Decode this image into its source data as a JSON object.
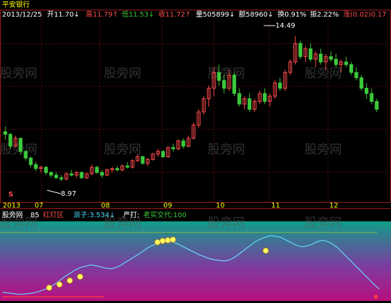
{
  "colors": {
    "up": "#ff4b4b",
    "down": "#3cc83c",
    "grid": "#a01818",
    "text_white": "#ffffff",
    "text_yellow": "#ffff00",
    "text_green": "#3cc83c",
    "text_red": "#ff4b4b",
    "text_cyan": "#55ddff",
    "axis_text": "#ffff00",
    "indicator_line": "#66d9ff",
    "marker_fill": "#ffff66",
    "ref_line": "#7fbf3f"
  },
  "header": {
    "stock_name": "平安银行",
    "date": "2013/12/25",
    "open_label": "开11.70↓",
    "high_label": "高11.79↑",
    "low_label": "低11.53↓",
    "close_label": "收11.72↑",
    "volume_label": "量505899↓",
    "amount_label": "额58960↓",
    "turnover_label": "换0.91%",
    "amplitude_label": "振2.22%",
    "change_label": "涨(0.02)0.17"
  },
  "annotations": {
    "high_marker": "14.49",
    "low_marker": "8.97",
    "s_marker": "S"
  },
  "xaxis": {
    "labels": [
      "2013",
      "07",
      "08",
      "09",
      "10",
      "11",
      "12"
    ]
  },
  "indicator": {
    "name": "股旁网",
    "value": "85",
    "signal_label": "红灯区",
    "wave_label": "浪子:3.534↓",
    "strike_label": "严打:",
    "ref_label": "老实交代:100"
  },
  "watermark": "股旁网",
  "chart_data": {
    "type": "candlestick",
    "title": "平安银行",
    "ylabel": "",
    "xlabel": "",
    "ylim": [
      8.6,
      14.8
    ],
    "x_tick_labels": [
      "2013",
      "07",
      "08",
      "09",
      "10",
      "11",
      "12"
    ],
    "candles_ohlc": [
      [
        10.85,
        11.05,
        10.55,
        10.75
      ],
      [
        10.75,
        10.8,
        10.2,
        10.3
      ],
      [
        10.3,
        10.7,
        10.25,
        10.6
      ],
      [
        10.6,
        10.62,
        10.0,
        10.1
      ],
      [
        10.1,
        10.15,
        9.75,
        9.85
      ],
      [
        9.85,
        9.9,
        9.5,
        9.6
      ],
      [
        9.6,
        9.7,
        9.35,
        9.45
      ],
      [
        9.45,
        9.55,
        9.3,
        9.5
      ],
      [
        9.5,
        9.55,
        9.2,
        9.3
      ],
      [
        9.3,
        9.35,
        9.1,
        9.2
      ],
      [
        9.2,
        9.3,
        9.05,
        9.1
      ],
      [
        9.1,
        9.2,
        8.97,
        9.05
      ],
      [
        9.05,
        9.3,
        9.0,
        9.25
      ],
      [
        9.25,
        9.4,
        9.15,
        9.2
      ],
      [
        9.2,
        9.35,
        9.1,
        9.3
      ],
      [
        9.3,
        9.35,
        9.05,
        9.1
      ],
      [
        9.1,
        9.3,
        9.05,
        9.25
      ],
      [
        9.25,
        9.6,
        9.2,
        9.5
      ],
      [
        9.5,
        9.55,
        9.25,
        9.3
      ],
      [
        9.3,
        9.4,
        9.1,
        9.2
      ],
      [
        9.2,
        9.45,
        9.15,
        9.4
      ],
      [
        9.4,
        9.5,
        9.3,
        9.45
      ],
      [
        9.45,
        9.55,
        9.35,
        9.4
      ],
      [
        9.4,
        9.6,
        9.35,
        9.55
      ],
      [
        9.55,
        9.7,
        9.45,
        9.5
      ],
      [
        9.5,
        9.8,
        9.45,
        9.75
      ],
      [
        9.75,
        10.0,
        9.7,
        9.9
      ],
      [
        9.9,
        9.95,
        9.6,
        9.65
      ],
      [
        9.65,
        9.85,
        9.55,
        9.8
      ],
      [
        9.8,
        10.05,
        9.75,
        10.0
      ],
      [
        10.0,
        10.2,
        9.9,
        10.1
      ],
      [
        10.1,
        10.15,
        9.85,
        9.9
      ],
      [
        9.9,
        10.3,
        9.85,
        10.25
      ],
      [
        10.25,
        10.4,
        10.1,
        10.2
      ],
      [
        10.2,
        10.55,
        10.15,
        10.5
      ],
      [
        10.5,
        10.6,
        10.2,
        10.3
      ],
      [
        10.3,
        10.7,
        10.25,
        10.6
      ],
      [
        10.6,
        11.2,
        10.55,
        11.1
      ],
      [
        11.1,
        11.7,
        11.0,
        11.6
      ],
      [
        11.6,
        12.2,
        11.5,
        12.1
      ],
      [
        12.1,
        12.6,
        11.8,
        12.5
      ],
      [
        12.5,
        13.3,
        12.2,
        13.1
      ],
      [
        13.1,
        13.4,
        12.6,
        12.8
      ],
      [
        12.8,
        13.0,
        12.3,
        12.5
      ],
      [
        12.5,
        13.2,
        12.4,
        13.0
      ],
      [
        13.0,
        13.1,
        12.2,
        12.3
      ],
      [
        12.3,
        12.5,
        11.8,
        11.9
      ],
      [
        11.9,
        12.2,
        11.7,
        12.1
      ],
      [
        12.1,
        12.3,
        11.6,
        11.7
      ],
      [
        11.7,
        12.1,
        11.6,
        12.0
      ],
      [
        12.0,
        12.4,
        11.9,
        12.3
      ],
      [
        12.3,
        12.5,
        11.9,
        12.0
      ],
      [
        12.0,
        12.3,
        11.8,
        12.2
      ],
      [
        12.2,
        12.8,
        12.1,
        12.7
      ],
      [
        12.7,
        12.9,
        12.4,
        12.5
      ],
      [
        12.5,
        13.2,
        12.4,
        13.1
      ],
      [
        13.1,
        13.6,
        13.0,
        13.5
      ],
      [
        13.5,
        14.49,
        13.4,
        14.2
      ],
      [
        14.2,
        14.3,
        13.6,
        13.7
      ],
      [
        13.7,
        14.1,
        13.5,
        14.0
      ],
      [
        14.0,
        14.2,
        13.5,
        13.6
      ],
      [
        13.6,
        13.9,
        13.3,
        13.8
      ],
      [
        13.8,
        14.0,
        13.4,
        13.5
      ],
      [
        13.5,
        13.8,
        13.2,
        13.7
      ],
      [
        13.7,
        13.9,
        13.5,
        13.6
      ],
      [
        13.6,
        13.8,
        13.3,
        13.4
      ],
      [
        13.4,
        13.6,
        13.1,
        13.5
      ],
      [
        13.5,
        13.7,
        13.3,
        13.4
      ],
      [
        13.4,
        13.5,
        13.0,
        13.1
      ],
      [
        13.1,
        13.3,
        12.8,
        12.9
      ],
      [
        12.9,
        13.0,
        12.4,
        12.5
      ],
      [
        12.5,
        12.7,
        12.1,
        12.3
      ],
      [
        12.3,
        12.5,
        11.9,
        12.0
      ],
      [
        12.0,
        12.1,
        11.6,
        11.7
      ]
    ],
    "indicator_series": [
      8,
      7,
      6,
      5,
      5,
      6,
      7,
      9,
      12,
      15,
      20,
      26,
      32,
      37,
      42,
      46,
      48,
      50,
      49,
      47,
      45,
      44,
      46,
      50,
      55,
      60,
      65,
      70,
      76,
      80,
      83,
      85,
      86,
      85,
      82,
      78,
      74,
      70,
      66,
      63,
      60,
      58,
      57,
      56,
      58,
      62,
      68,
      74,
      80,
      86,
      90,
      93,
      95,
      94,
      92,
      88,
      84,
      80,
      78,
      79,
      82,
      86,
      88,
      86,
      82,
      76,
      68,
      60,
      52,
      44,
      36,
      28,
      20,
      13
    ],
    "indicator_ylim": [
      0,
      100
    ],
    "indicator_markers": [
      {
        "index": 9,
        "value": 15
      },
      {
        "index": 11,
        "value": 20
      },
      {
        "index": 13,
        "value": 26
      },
      {
        "index": 15,
        "value": 32
      },
      {
        "index": 30,
        "value": 85
      },
      {
        "index": 31,
        "value": 87
      },
      {
        "index": 32,
        "value": 88
      },
      {
        "index": 33,
        "value": 89
      },
      {
        "index": 51,
        "value": 72
      }
    ],
    "indicator_ref_line": 100
  }
}
